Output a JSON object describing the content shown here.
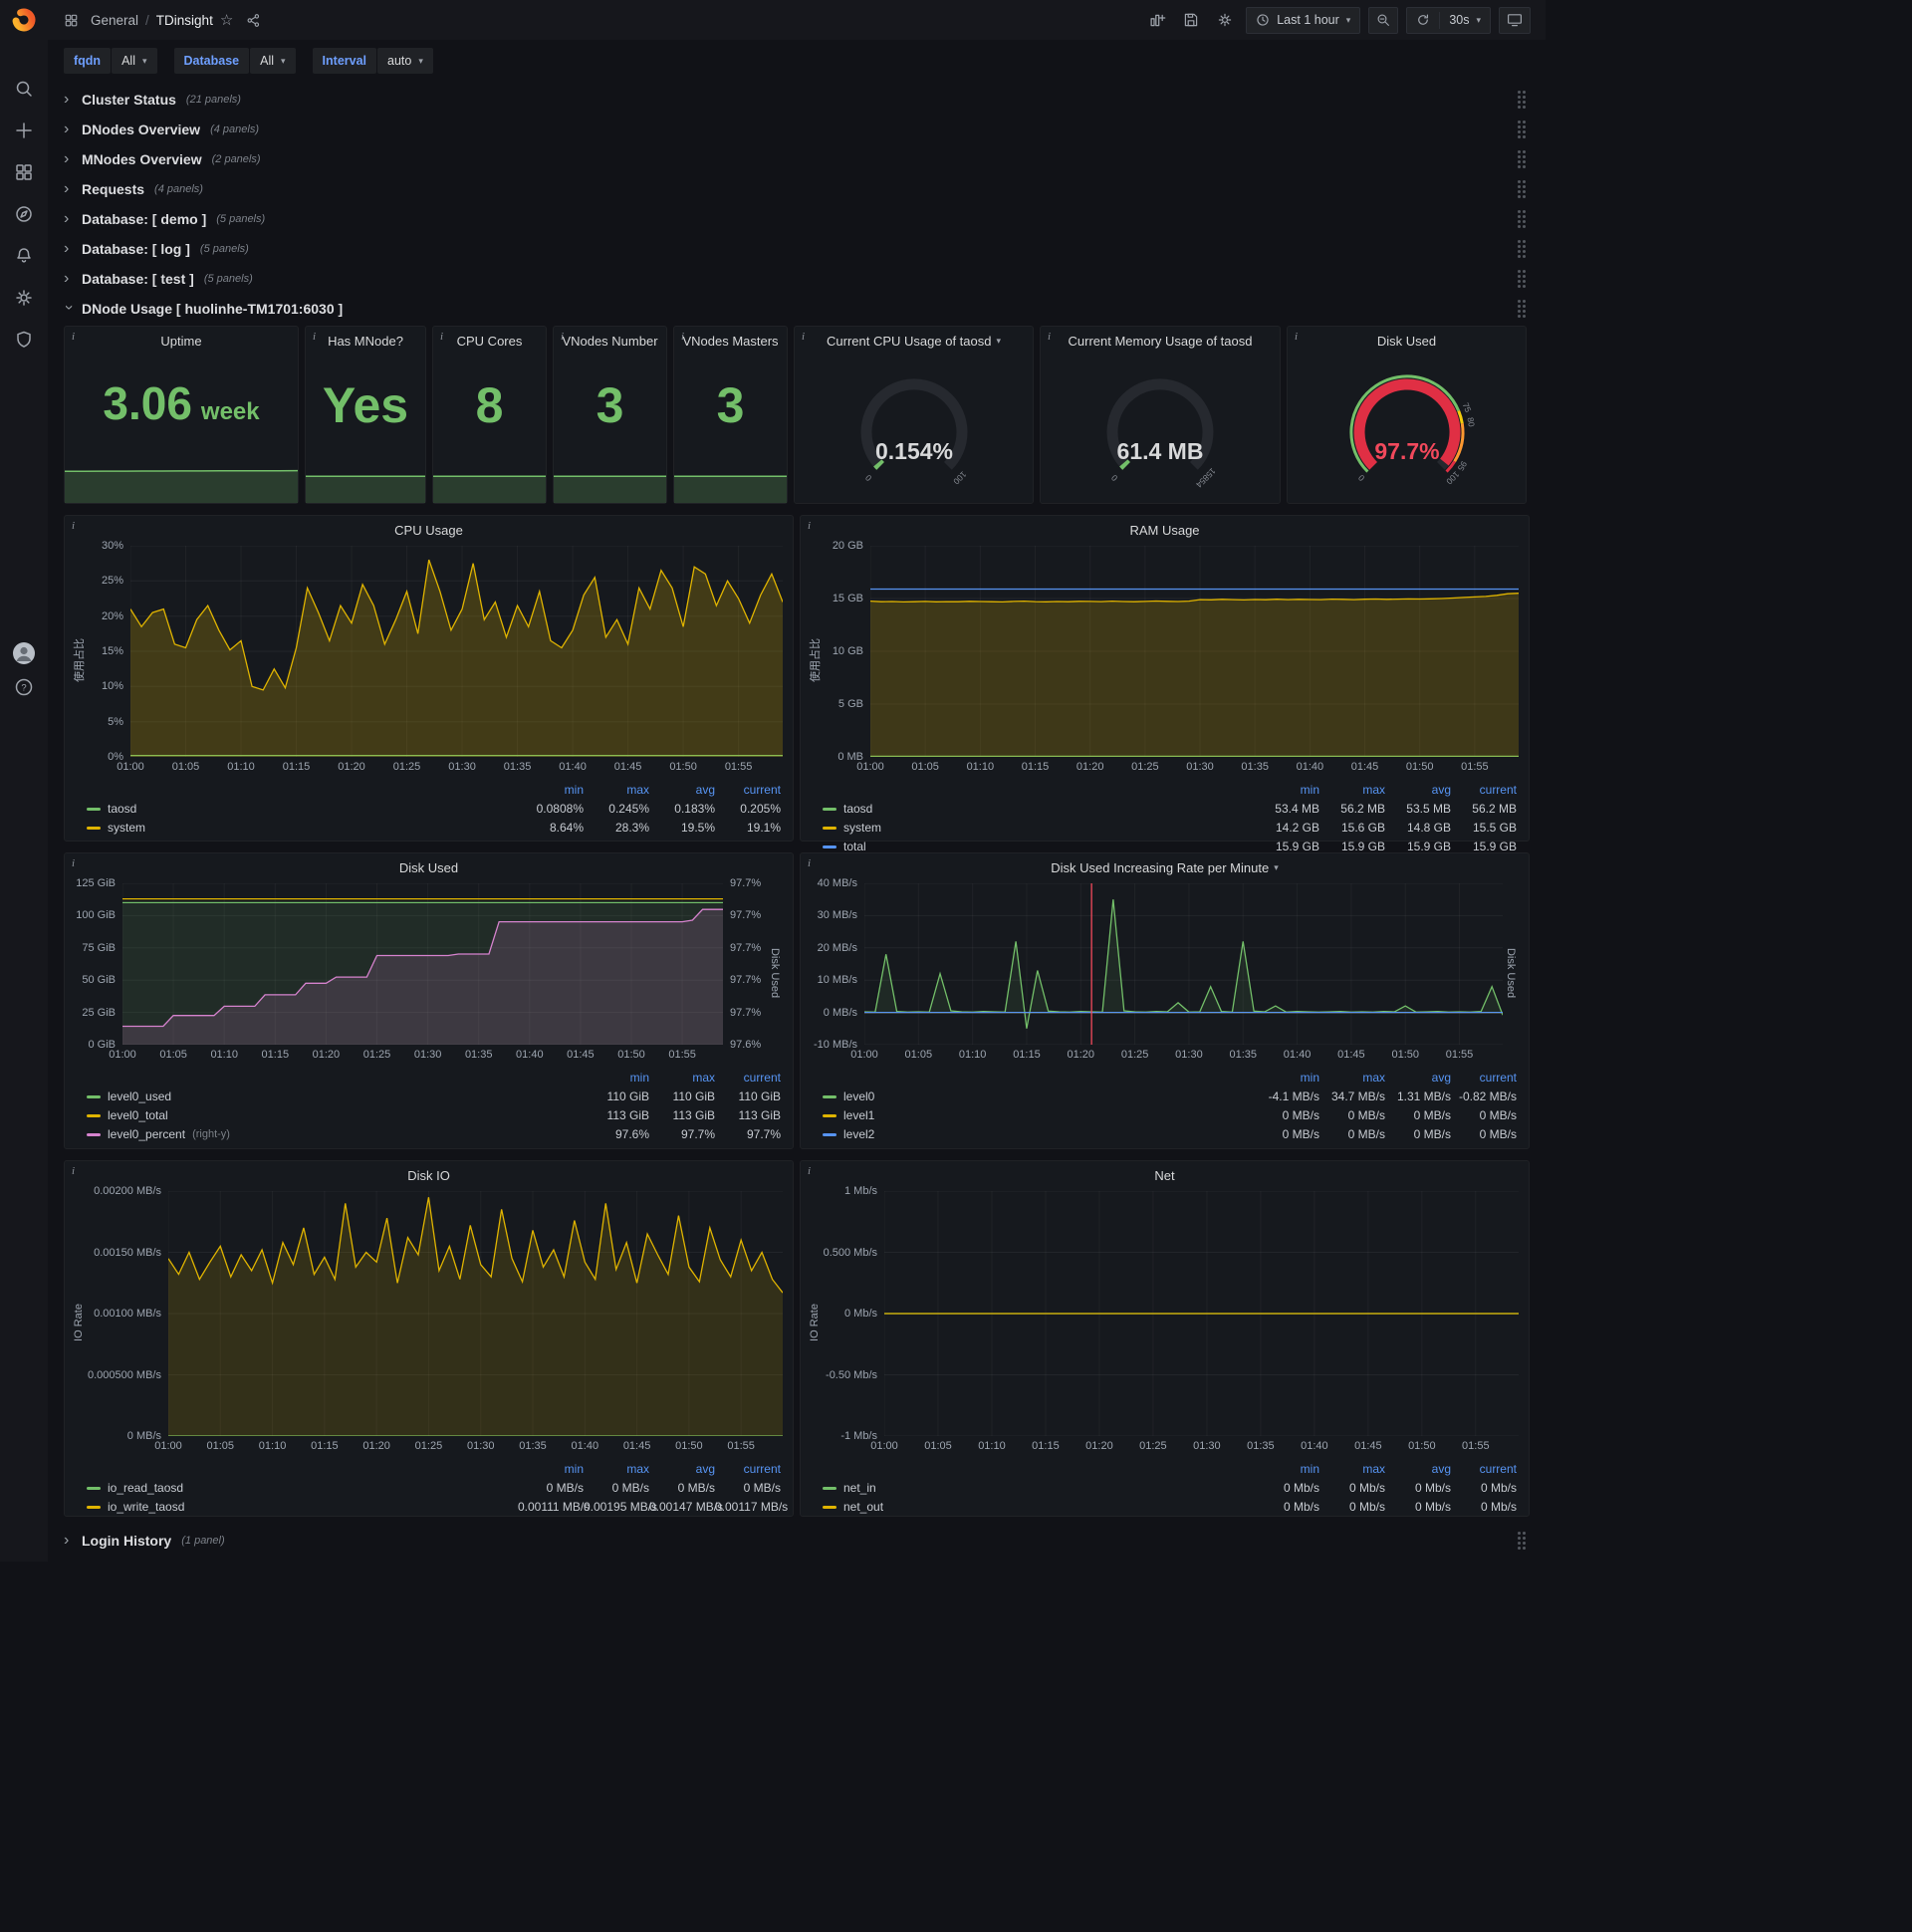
{
  "nav": {
    "breadcrumb": {
      "section": "General",
      "separator": "/",
      "title": "TDinsight"
    },
    "time_range_label": "Last 1 hour",
    "refresh_interval": "30s"
  },
  "variables": [
    {
      "label": "fqdn",
      "value": "All"
    },
    {
      "label": "Database",
      "value": "All"
    },
    {
      "label": "Interval",
      "value": "auto"
    }
  ],
  "collapsed_rows": [
    {
      "title": "Cluster Status",
      "panels": "(21 panels)"
    },
    {
      "title": "DNodes Overview",
      "panels": "(4 panels)"
    },
    {
      "title": "MNodes Overview",
      "panels": "(2 panels)"
    },
    {
      "title": "Requests",
      "panels": "(4 panels)"
    },
    {
      "title": "Database: [ demo ]",
      "panels": "(5 panels)"
    },
    {
      "title": "Database: [ log ]",
      "panels": "(5 panels)"
    },
    {
      "title": "Database: [ test ]",
      "panels": "(5 panels)"
    }
  ],
  "expanded_row": {
    "title": "DNode Usage [ huolinhe-TM1701:6030 ]"
  },
  "bottom_row": {
    "title": "Login History",
    "panels": "(1 panel)"
  },
  "stat_panels": [
    {
      "id": "uptime",
      "title": "Uptime",
      "value": "3.06",
      "unit": "week",
      "spark": {
        "values": [
          3,
          3.005,
          3.01,
          3.015,
          3.02,
          3.025,
          3.03,
          3.035,
          3.04,
          3.045,
          3.05,
          3.055,
          3.06
        ],
        "ylim": [
          0,
          3.4
        ]
      }
    },
    {
      "id": "has-mnode",
      "title": "Has MNode?",
      "value": "Yes",
      "unit": "",
      "spark": {
        "const": 1,
        "points": 13,
        "ylim": [
          0,
          1.12
        ]
      }
    },
    {
      "id": "cpu-cores",
      "title": "CPU Cores",
      "value": "8",
      "unit": "",
      "spark": {
        "const": 1,
        "points": 13,
        "ylim": [
          0,
          1.12
        ]
      }
    },
    {
      "id": "vnodes-number",
      "title": "VNodes Number",
      "value": "3",
      "unit": "",
      "spark": {
        "const": 1,
        "points": 13,
        "ylim": [
          0,
          1.12
        ]
      }
    },
    {
      "id": "vnodes-masters",
      "title": "VNodes Masters",
      "value": "3",
      "unit": "",
      "spark": {
        "const": 1,
        "points": 13,
        "ylim": [
          0,
          1.12
        ]
      }
    }
  ],
  "gauge_panels": [
    {
      "id": "cpu-gauge",
      "title": "Current CPU Usage of taosd",
      "has_menu": true,
      "value_text": "0.154%",
      "fraction": 0.00154,
      "min_label": "0",
      "max_label": "100",
      "value_color": "#d8d9da",
      "bar_color": "#73bf69"
    },
    {
      "id": "mem-gauge",
      "title": "Current Memory Usage of taosd",
      "value_text": "61.4 MB",
      "fraction": 0.0039,
      "min_label": "0",
      "max_label": "15854",
      "value_color": "#d8d9da",
      "bar_color": "#73bf69"
    },
    {
      "id": "disk-gauge",
      "title": "Disk Used",
      "value_text": "97.7%",
      "fraction": 0.977,
      "min_label": "0",
      "max_label": "100",
      "value_color": "#f2495c",
      "bar_color": "#e02f44",
      "threshold_labels": [
        {
          "pos": 0.75,
          "label": "75"
        },
        {
          "pos": 0.8,
          "label": "80"
        },
        {
          "pos": 0.95,
          "label": "95"
        }
      ],
      "ring": [
        {
          "from": 0,
          "to": 0.75,
          "color": "#73bf69"
        },
        {
          "from": 0.75,
          "to": 0.8,
          "color": "#f2cc0c"
        },
        {
          "from": 0.8,
          "to": 0.95,
          "color": "#ff9830"
        },
        {
          "from": 0.95,
          "to": 1,
          "color": "#e02f44"
        }
      ]
    }
  ],
  "chart_data": [
    {
      "id": "cpu_usage",
      "type": "line",
      "title": "CPU Usage",
      "ylabel": "使用占比",
      "row": 1,
      "yticks": [
        "30%",
        "25%",
        "20%",
        "15%",
        "10%",
        "5%",
        "0%"
      ],
      "ylim": [
        0,
        30
      ],
      "x_labels": [
        "01:00",
        "01:05",
        "01:10",
        "01:15",
        "01:20",
        "01:25",
        "01:30",
        "01:35",
        "01:40",
        "01:45",
        "01:50",
        "01:55"
      ],
      "points": 60,
      "legend_columns": [
        "min",
        "max",
        "avg",
        "current"
      ],
      "series": [
        {
          "name": "taosd",
          "color": "#73bf69",
          "const": 0.2,
          "legend": [
            "0.0808%",
            "0.245%",
            "0.183%",
            "0.205%"
          ]
        },
        {
          "name": "system",
          "color": "#e0b400",
          "fill": 0.22,
          "values": [
            21,
            18.5,
            20.5,
            21,
            16,
            15.5,
            19.5,
            21.5,
            18,
            15.2,
            16.5,
            10,
            9.5,
            12.5,
            9.8,
            15.5,
            24,
            20.5,
            16.5,
            21.5,
            19,
            24.5,
            21.5,
            16,
            19.5,
            23.5,
            17.5,
            28,
            23.5,
            18,
            21,
            27.5,
            19.5,
            22,
            17,
            21.5,
            18.5,
            23.5,
            16.5,
            15.5,
            18,
            23,
            25.5,
            17,
            19.5,
            16,
            24,
            21,
            26.5,
            24,
            18.5,
            27,
            26,
            21.5,
            25,
            22.5,
            19,
            23,
            26,
            22
          ],
          "legend": [
            "8.64%",
            "28.3%",
            "19.5%",
            "19.1%"
          ]
        }
      ]
    },
    {
      "id": "ram_usage",
      "type": "line",
      "title": "RAM Usage",
      "ylabel": "使用占比",
      "row": 1,
      "yticks": [
        "20 GB",
        "15 GB",
        "10 GB",
        "5 GB",
        "0 MB"
      ],
      "ylim": [
        0,
        20
      ],
      "x_labels": [
        "01:00",
        "01:05",
        "01:10",
        "01:15",
        "01:20",
        "01:25",
        "01:30",
        "01:35",
        "01:40",
        "01:45",
        "01:50",
        "01:55"
      ],
      "points": 60,
      "legend_columns": [
        "min",
        "max",
        "avg",
        "current"
      ],
      "series": [
        {
          "name": "taosd",
          "color": "#73bf69",
          "const": 0.055,
          "legend": [
            "53.4 MB",
            "56.2 MB",
            "53.5 MB",
            "56.2 MB"
          ]
        },
        {
          "name": "system",
          "color": "#e0b400",
          "fill": 0.2,
          "values": [
            14.75,
            14.7,
            14.72,
            14.68,
            14.7,
            14.73,
            14.69,
            14.71,
            14.7,
            14.74,
            14.72,
            14.7,
            14.68,
            14.73,
            14.75,
            14.71,
            14.69,
            14.72,
            14.7,
            14.74,
            14.73,
            14.71,
            14.75,
            14.72,
            14.7,
            14.73,
            14.76,
            14.74,
            14.72,
            14.75,
            14.9,
            14.88,
            14.92,
            14.9,
            14.87,
            14.91,
            14.89,
            14.93,
            14.9,
            14.92,
            14.91,
            14.9,
            14.94,
            14.92,
            14.9,
            14.93,
            14.95,
            14.92,
            14.94,
            14.96,
            14.95,
            14.97,
            15,
            15.05,
            15.1,
            15.15,
            15.2,
            15.3,
            15.45,
            15.5
          ],
          "legend": [
            "14.2 GB",
            "15.6 GB",
            "14.8 GB",
            "15.5 GB"
          ]
        },
        {
          "name": "total",
          "color": "#5794f2",
          "const": 15.9,
          "legend": [
            "15.9 GB",
            "15.9 GB",
            "15.9 GB",
            "15.9 GB"
          ]
        }
      ]
    },
    {
      "id": "disk_used",
      "type": "line",
      "title": "Disk Used",
      "ylabel_right": "Disk Used",
      "row": 2,
      "yticks": [
        "125 GiB",
        "100 GiB",
        "75 GiB",
        "50 GiB",
        "25 GiB",
        "0 GiB"
      ],
      "ylim": [
        0,
        125
      ],
      "yticks_right": [
        "97.7%",
        "97.7%",
        "97.7%",
        "97.7%",
        "97.7%",
        "97.6%"
      ],
      "ylim_right": [
        97.55,
        97.76
      ],
      "x_labels": [
        "01:00",
        "01:05",
        "01:10",
        "01:15",
        "01:20",
        "01:25",
        "01:30",
        "01:35",
        "01:40",
        "01:45",
        "01:50",
        "01:55"
      ],
      "points": 60,
      "legend_columns": [
        "min",
        "max",
        "current"
      ],
      "series": [
        {
          "name": "level0_used",
          "color": "#73bf69",
          "fill": 0.12,
          "const": 110,
          "legend": [
            "110 GiB",
            "110 GiB",
            "110 GiB"
          ]
        },
        {
          "name": "level0_total",
          "color": "#e0b400",
          "const": 113,
          "legend": [
            "113 GiB",
            "113 GiB",
            "113 GiB"
          ]
        },
        {
          "name": "level0_percent",
          "suffix": "(right-y)",
          "color": "#d683ce",
          "axis": "right",
          "fill": 0.16,
          "values": [
            97.574,
            97.574,
            97.574,
            97.574,
            97.574,
            97.588,
            97.588,
            97.588,
            97.588,
            97.588,
            97.6,
            97.6,
            97.6,
            97.6,
            97.615,
            97.615,
            97.615,
            97.615,
            97.63,
            97.63,
            97.63,
            97.638,
            97.638,
            97.638,
            97.638,
            97.666,
            97.666,
            97.666,
            97.666,
            97.666,
            97.666,
            97.666,
            97.666,
            97.668,
            97.668,
            97.668,
            97.668,
            97.71,
            97.71,
            97.71,
            97.71,
            97.71,
            97.71,
            97.71,
            97.71,
            97.71,
            97.71,
            97.71,
            97.71,
            97.71,
            97.71,
            97.71,
            97.71,
            97.71,
            97.71,
            97.71,
            97.712,
            97.726,
            97.726,
            97.726
          ],
          "legend": [
            "97.6%",
            "97.7%",
            "97.7%"
          ]
        }
      ]
    },
    {
      "id": "disk_rate",
      "type": "line",
      "title": "Disk Used Increasing Rate per Minute",
      "has_menu": true,
      "ylabel_right": "Disk Used",
      "row": 2,
      "yticks": [
        "40 MB/s",
        "30 MB/s",
        "20 MB/s",
        "10 MB/s",
        "0 MB/s",
        "-10 MB/s"
      ],
      "ylim": [
        -10,
        40
      ],
      "x_labels": [
        "01:00",
        "01:05",
        "01:10",
        "01:15",
        "01:20",
        "01:25",
        "01:30",
        "01:35",
        "01:40",
        "01:45",
        "01:50",
        "01:55"
      ],
      "points": 60,
      "annotation_index": 21,
      "annotation_color": "#f2495c",
      "legend_columns": [
        "min",
        "max",
        "avg",
        "current"
      ],
      "series": [
        {
          "name": "level0",
          "color": "#73bf69",
          "fill": 0.1,
          "values": [
            0.2,
            0.1,
            18,
            0.3,
            0.1,
            0.2,
            0.1,
            12,
            0.5,
            0.2,
            0.1,
            0.3,
            0.2,
            0.1,
            22,
            -5,
            13,
            0.4,
            0.2,
            0.1,
            0.3,
            0.2,
            0.1,
            35,
            0.5,
            0.2,
            0.1,
            0.3,
            0.2,
            3,
            0.1,
            0.2,
            8,
            0.3,
            0.1,
            22,
            0.4,
            0.2,
            2,
            0.1,
            0.3,
            0.2,
            0.1,
            0.2,
            0.3,
            0.1,
            0.2,
            0.1,
            0.3,
            0.2,
            2,
            0.1,
            0.2,
            0.3,
            0.1,
            0.2,
            0.1,
            0.3,
            8,
            -0.8
          ],
          "legend": [
            "-4.1 MB/s",
            "34.7 MB/s",
            "1.31 MB/s",
            "-0.82 MB/s"
          ]
        },
        {
          "name": "level1",
          "color": "#e0b400",
          "const": 0,
          "legend": [
            "0 MB/s",
            "0 MB/s",
            "0 MB/s",
            "0 MB/s"
          ]
        },
        {
          "name": "level2",
          "color": "#5794f2",
          "const": 0,
          "legend": [
            "0 MB/s",
            "0 MB/s",
            "0 MB/s",
            "0 MB/s"
          ]
        }
      ]
    },
    {
      "id": "disk_io",
      "type": "line",
      "title": "Disk IO",
      "ylabel": "IO Rate",
      "row": 3,
      "yticks": [
        "0.00200 MB/s",
        "0.00150 MB/s",
        "0.00100 MB/s",
        "0.000500 MB/s",
        "0 MB/s"
      ],
      "ylim": [
        0,
        0.002
      ],
      "x_labels": [
        "01:00",
        "01:05",
        "01:10",
        "01:15",
        "01:20",
        "01:25",
        "01:30",
        "01:35",
        "01:40",
        "01:45",
        "01:50",
        "01:55"
      ],
      "points": 60,
      "legend_columns": [
        "min",
        "max",
        "avg",
        "current"
      ],
      "series": [
        {
          "name": "io_read_taosd",
          "color": "#73bf69",
          "const": 0,
          "legend": [
            "0 MB/s",
            "0 MB/s",
            "0 MB/s",
            "0 MB/s"
          ]
        },
        {
          "name": "io_write_taosd",
          "color": "#e0b400",
          "fill": 0.15,
          "values": [
            0.00145,
            0.00132,
            0.0015,
            0.00128,
            0.00142,
            0.00155,
            0.0013,
            0.00148,
            0.00135,
            0.00152,
            0.00125,
            0.00158,
            0.0014,
            0.0017,
            0.00132,
            0.00146,
            0.00128,
            0.0019,
            0.00138,
            0.0015,
            0.00142,
            0.00178,
            0.00125,
            0.00162,
            0.00148,
            0.00195,
            0.00135,
            0.00155,
            0.00128,
            0.00172,
            0.0014,
            0.0013,
            0.00185,
            0.00145,
            0.00126,
            0.00168,
            0.00138,
            0.00152,
            0.0013,
            0.00176,
            0.00142,
            0.00128,
            0.0019,
            0.00136,
            0.00158,
            0.00125,
            0.00165,
            0.00148,
            0.00132,
            0.0018,
            0.00138,
            0.00126,
            0.0017,
            0.00144,
            0.0013,
            0.0016,
            0.00135,
            0.0015,
            0.00128,
            0.00117
          ],
          "legend": [
            "0.00111 MB/s",
            "0.00195 MB/s",
            "0.00147 MB/s",
            "0.00117 MB/s"
          ]
        }
      ]
    },
    {
      "id": "net",
      "type": "line",
      "title": "Net",
      "ylabel": "IO Rate",
      "row": 3,
      "yticks": [
        "1 Mb/s",
        "0.500 Mb/s",
        "0 Mb/s",
        "-0.50 Mb/s",
        "-1 Mb/s"
      ],
      "ylim": [
        -1,
        1
      ],
      "x_labels": [
        "01:00",
        "01:05",
        "01:10",
        "01:15",
        "01:20",
        "01:25",
        "01:30",
        "01:35",
        "01:40",
        "01:45",
        "01:50",
        "01:55"
      ],
      "points": 60,
      "legend_columns": [
        "min",
        "max",
        "avg",
        "current"
      ],
      "series": [
        {
          "name": "net_in",
          "color": "#73bf69",
          "const": 0,
          "legend": [
            "0 Mb/s",
            "0 Mb/s",
            "0 Mb/s",
            "0 Mb/s"
          ]
        },
        {
          "name": "net_out",
          "color": "#e0b400",
          "const": 0,
          "legend": [
            "0 Mb/s",
            "0 Mb/s",
            "0 Mb/s",
            "0 Mb/s"
          ]
        }
      ]
    }
  ]
}
